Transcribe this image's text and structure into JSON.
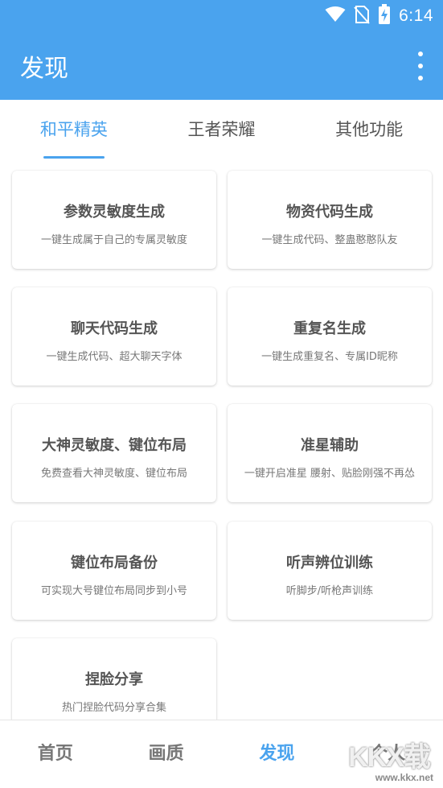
{
  "status_bar": {
    "time": "6:14"
  },
  "app_bar": {
    "title": "发现"
  },
  "tabs": [
    {
      "label": "和平精英",
      "active": true
    },
    {
      "label": "王者荣耀",
      "active": false
    },
    {
      "label": "其他功能",
      "active": false
    }
  ],
  "cards": [
    {
      "title": "参数灵敏度生成",
      "subtitle": "一键生成属于自己的专属灵敏度"
    },
    {
      "title": "物资代码生成",
      "subtitle": "一键生成代码、整蛊憨憨队友"
    },
    {
      "title": "聊天代码生成",
      "subtitle": "一键生成代码、超大聊天字体"
    },
    {
      "title": "重复名生成",
      "subtitle": "一键生成重复名、专属ID昵称"
    },
    {
      "title": "大神灵敏度、键位布局",
      "subtitle": "免费查看大神灵敏度、键位布局"
    },
    {
      "title": "准星辅助",
      "subtitle": "一键开启准星 腰射、贴脸刚强不再怂"
    },
    {
      "title": "键位布局备份",
      "subtitle": "可实现大号键位布局同步到小号"
    },
    {
      "title": "听声辨位训练",
      "subtitle": "听脚步/听枪声训练"
    },
    {
      "title": "捏脸分享",
      "subtitle": "热门捏脸代码分享合集"
    }
  ],
  "bottom_nav": [
    {
      "label": "首页",
      "active": false
    },
    {
      "label": "画质",
      "active": false
    },
    {
      "label": "发现",
      "active": true
    },
    {
      "label": "个人",
      "active": false
    }
  ],
  "watermark": {
    "logo": "KKX载",
    "site": "www.kkx.net"
  },
  "colors": {
    "primary": "#4aa3ee",
    "card_title": "#555555",
    "card_subtitle": "#777777"
  },
  "icons": {
    "status": [
      "wifi-icon",
      "no-sim-icon",
      "battery-charging-icon"
    ],
    "menu": "more-vert-icon"
  }
}
